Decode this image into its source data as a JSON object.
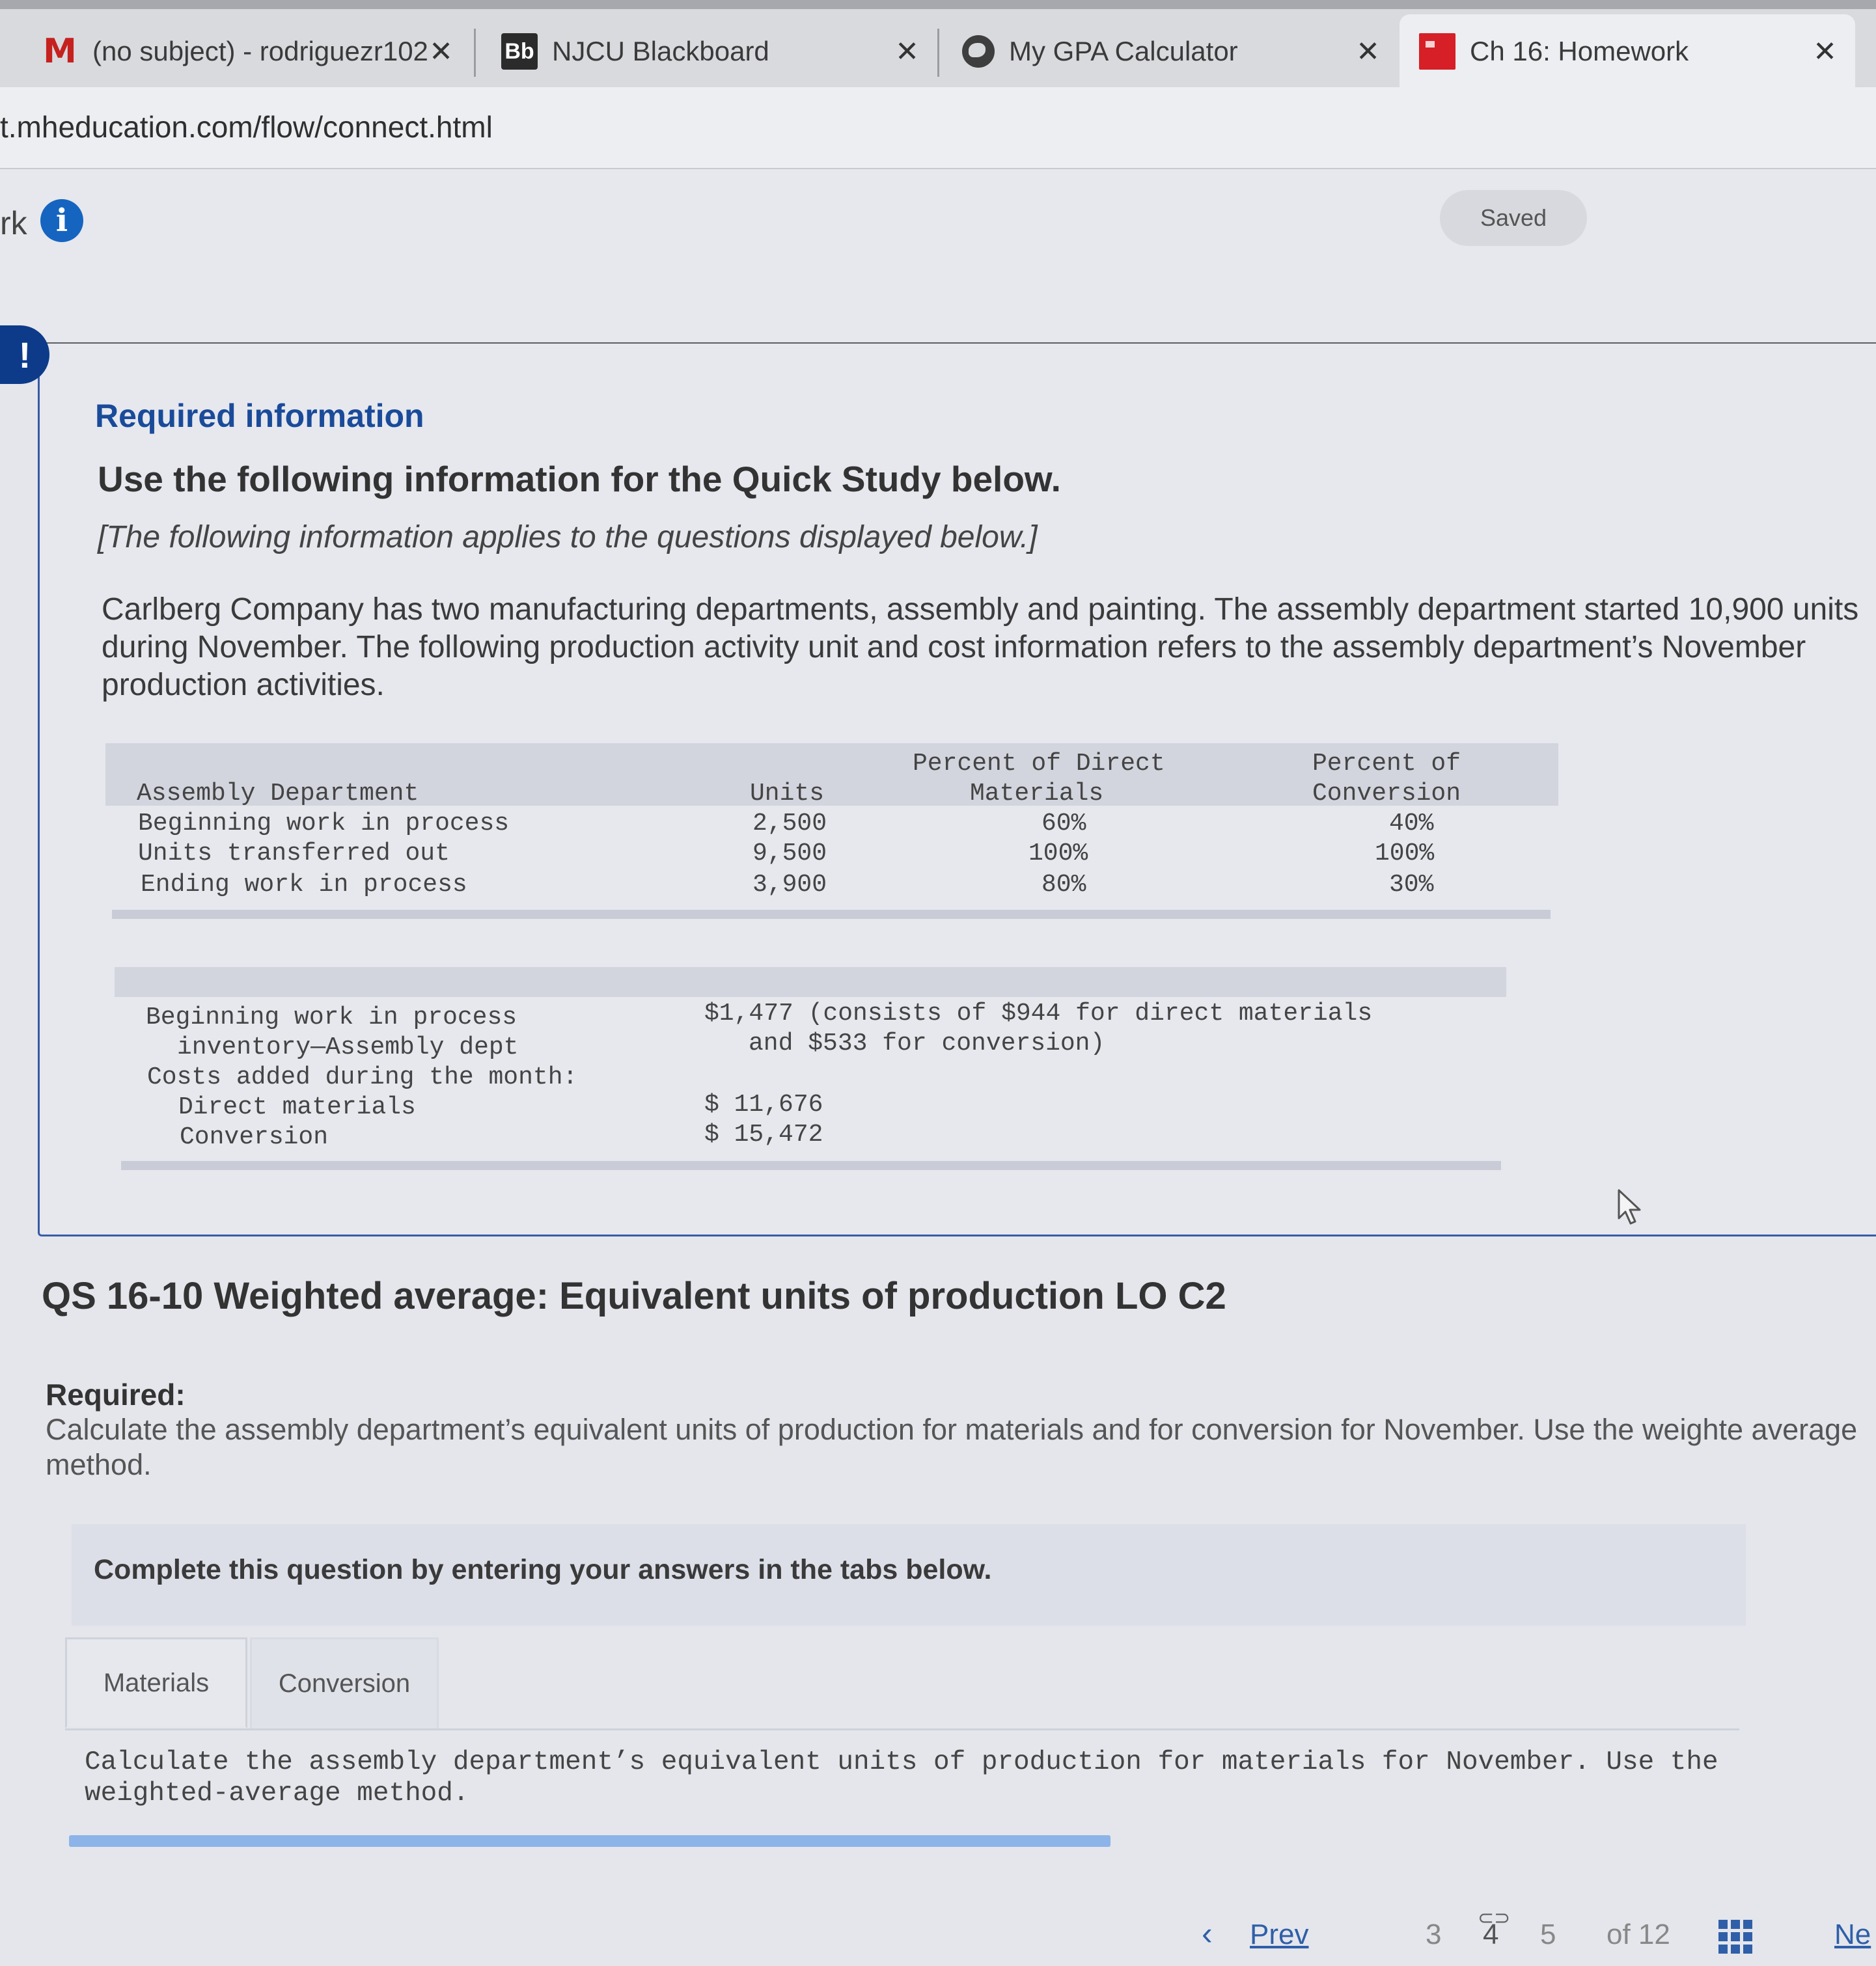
{
  "browser": {
    "tabs": [
      {
        "title": "(no subject) - rodriguezr102",
        "icon": "gmail-icon",
        "close": "✕"
      },
      {
        "title": "NJCU Blackboard",
        "icon": "blackboard-icon",
        "icon_text": "Bb",
        "close": "✕"
      },
      {
        "title": "My GPA Calculator",
        "icon": "globe-icon",
        "close": "✕"
      },
      {
        "title": "Ch 16: Homework",
        "icon": "mcgraw-hill-icon",
        "close": "✕"
      }
    ],
    "url": "t.mheducation.com/flow/connect.html"
  },
  "header": {
    "title_fragment": "rk",
    "saved_label": "Saved"
  },
  "required_info": {
    "heading": "Required information",
    "subheading": "Use the following information for the Quick Study below.",
    "applies_note": "[The following information applies to the questions displayed below.]",
    "paragraph": "Carlberg Company has two manufacturing departments, assembly and painting. The assembly department started 10,900 units during November. The following production activity unit and cost information refers to the assembly department’s November production activities.",
    "units_table": {
      "headers": {
        "department": "Assembly Department",
        "units": "Units",
        "direct_materials_line1": "Percent of Direct",
        "direct_materials_line2": "Materials",
        "conversion_line1": "Percent of",
        "conversion_line2": "Conversion"
      },
      "rows": [
        {
          "label": "Beginning work in process",
          "units": "2,500",
          "dm": "60%",
          "conv": "40%"
        },
        {
          "label": "Units transferred out",
          "units": "9,500",
          "dm": "100%",
          "conv": "100%"
        },
        {
          "label": "Ending work in process",
          "units": "3,900",
          "dm": "80%",
          "conv": "30%"
        }
      ]
    },
    "cost_table": {
      "beginning_line1": "Beginning work in process",
      "beginning_line2": "inventory—Assembly dept",
      "beginning_value_line1": "$1,477 (consists of $944 for direct materials",
      "beginning_value_line2": "and $533 for conversion)",
      "costs_added": "Costs added during the month:",
      "direct_materials_label": "Direct materials",
      "direct_materials_value": "$ 11,676",
      "conversion_label": "Conversion",
      "conversion_value": "$ 15,472"
    }
  },
  "question": {
    "title": "QS 16-10 Weighted average: Equivalent units of production LO C2",
    "required_label": "Required:",
    "required_text": "Calculate the assembly department’s equivalent units of production for materials and for conversion for November. Use the weighte average method.",
    "instruction": "Complete this question by entering your answers in the tabs below.",
    "tabs": [
      "Materials",
      "Conversion"
    ],
    "tab_body": "Calculate the assembly department’s equivalent units of production for materials for November. Use the weighted-average method."
  },
  "pagination": {
    "prev_label": "Prev",
    "pages": [
      "3",
      "4",
      "5"
    ],
    "of_label": "of 12",
    "next_label": "Ne"
  },
  "colors": {
    "accent": "#1a4b9a",
    "link": "#2f5fa8",
    "alert": "#0d3b8a",
    "progress": "#8db4e8"
  }
}
